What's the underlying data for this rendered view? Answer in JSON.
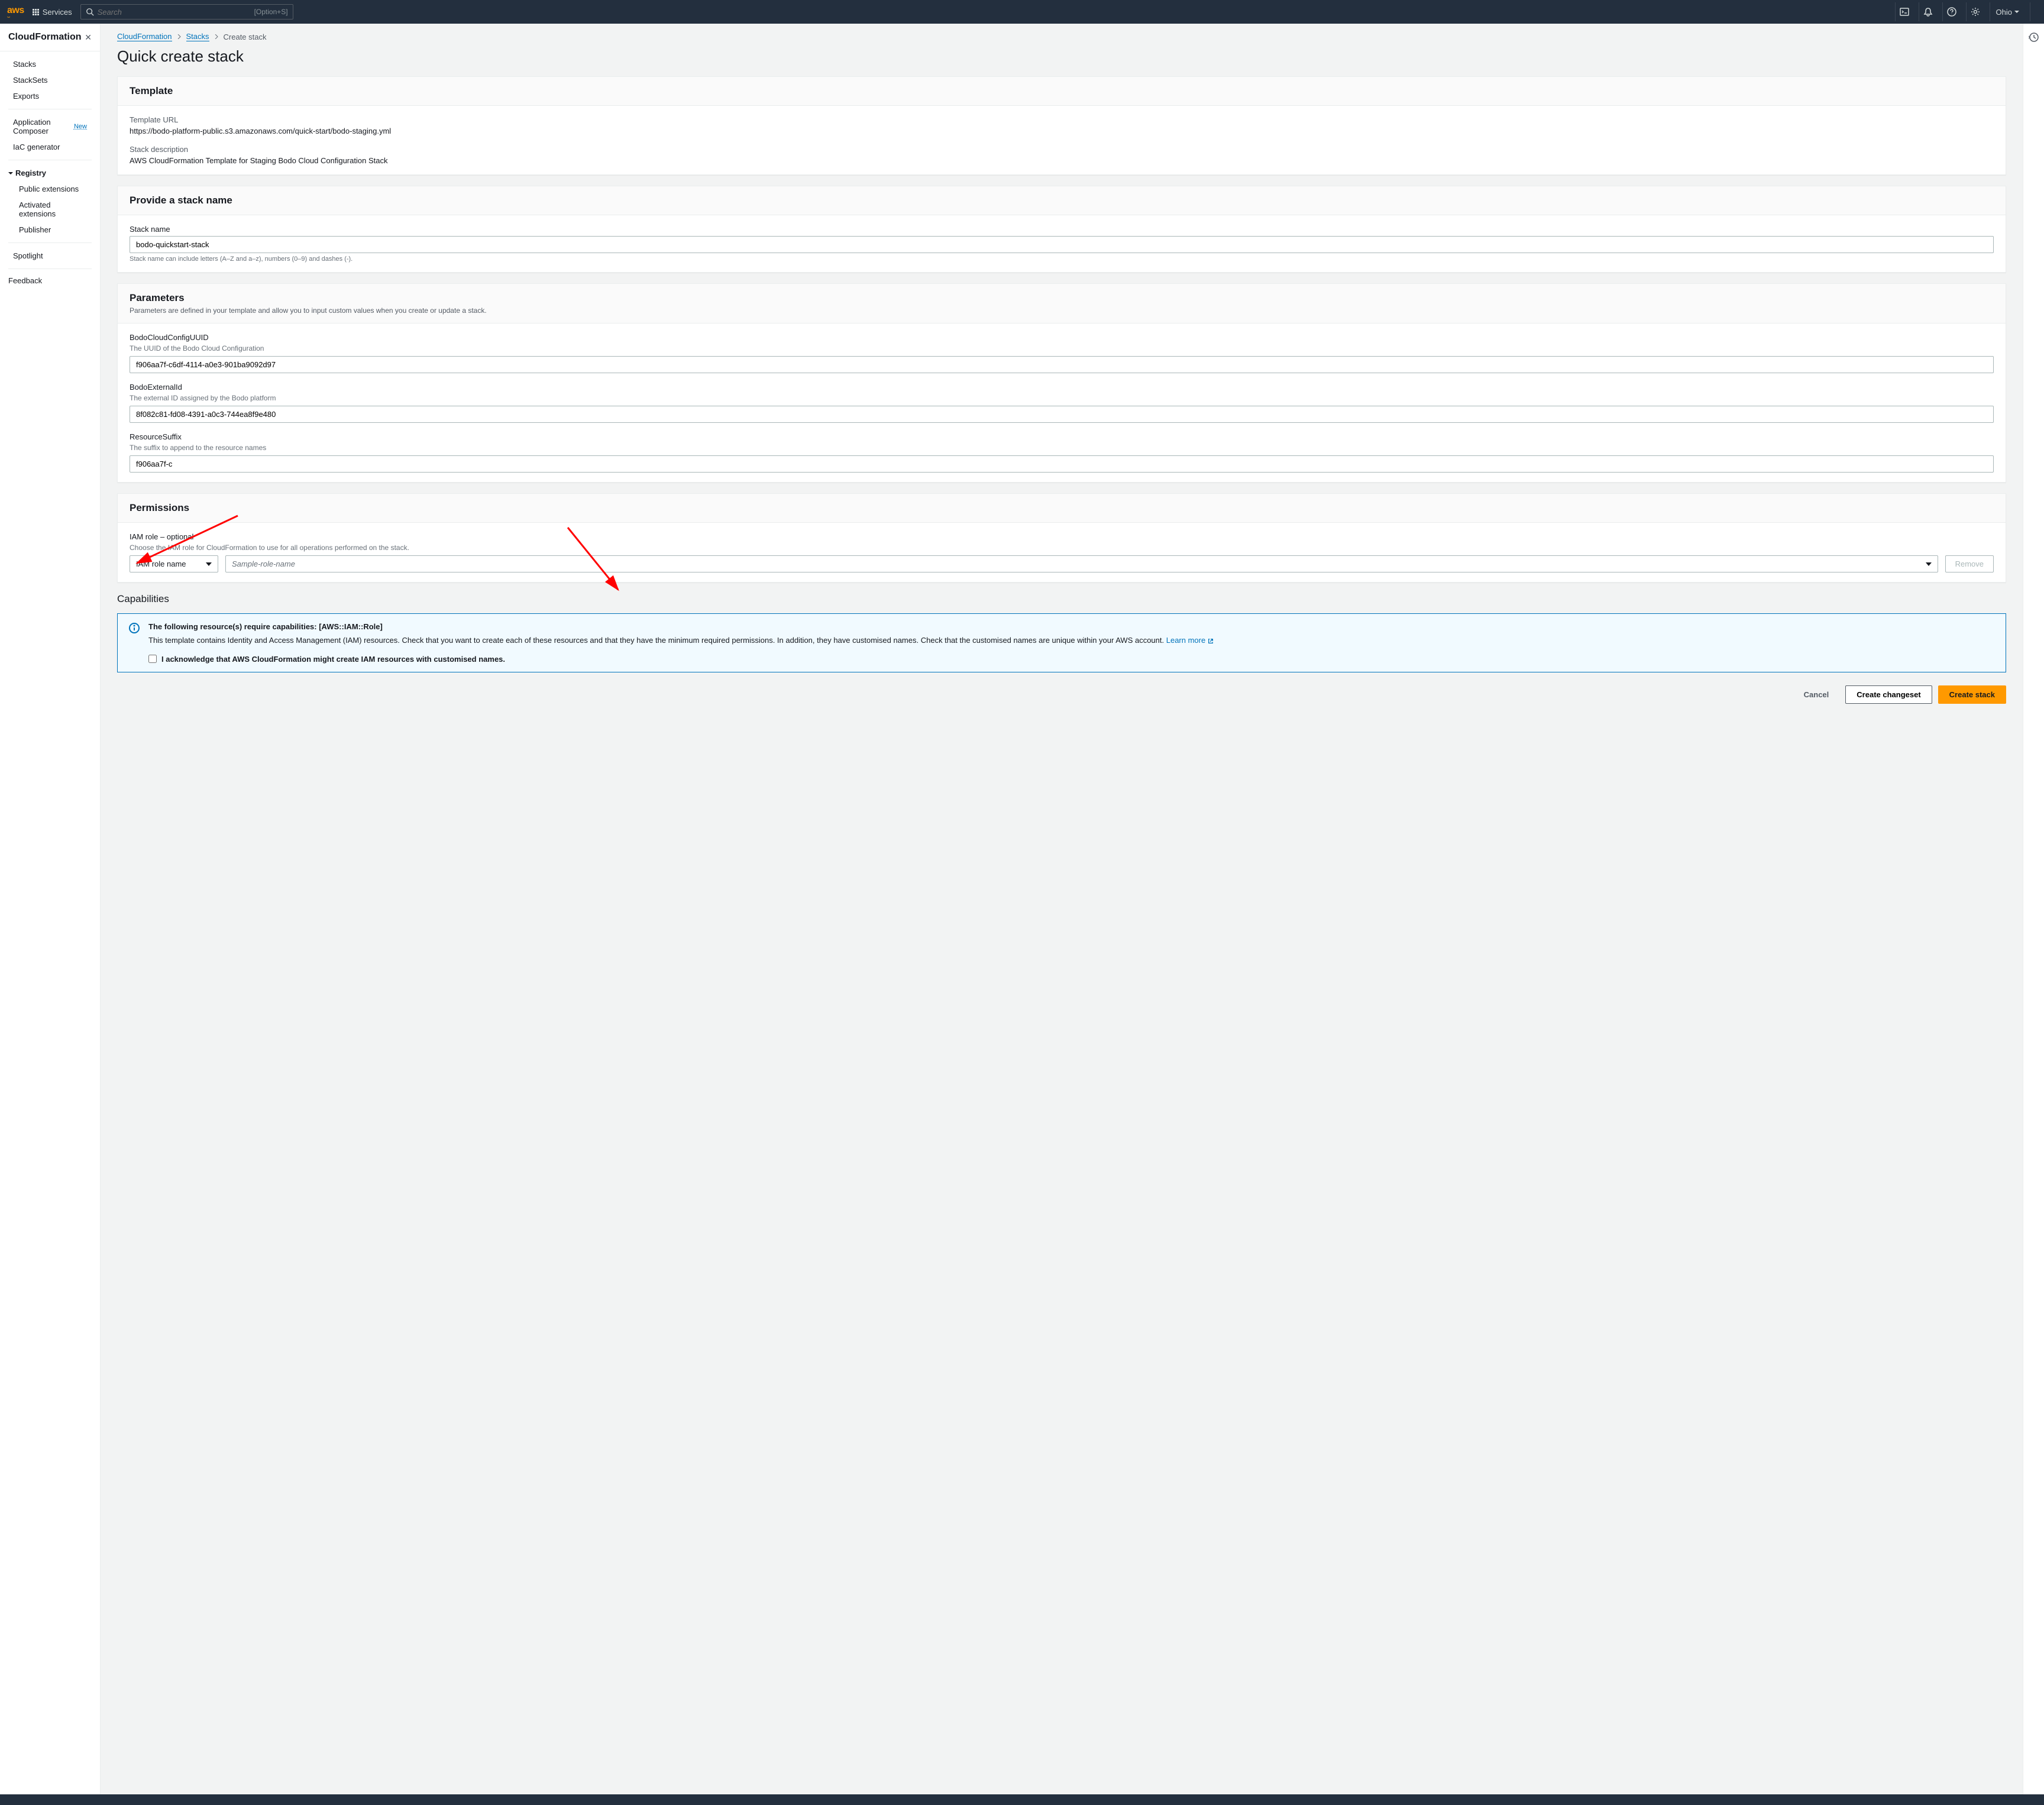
{
  "topnav": {
    "logo": "aws",
    "services_label": "Services",
    "search_placeholder": "Search",
    "search_shortcut": "[Option+S]",
    "region": "Ohio"
  },
  "sidebar": {
    "title": "CloudFormation",
    "section1": [
      "Stacks",
      "StackSets",
      "Exports"
    ],
    "section2": [
      {
        "label": "Application Composer",
        "badge": "New"
      },
      {
        "label": "IaC generator",
        "badge": null
      }
    ],
    "registry_label": "Registry",
    "registry_items": [
      "Public extensions",
      "Activated extensions",
      "Publisher"
    ],
    "section4": [
      "Spotlight"
    ],
    "feedback": "Feedback"
  },
  "breadcrumbs": {
    "items": [
      "CloudFormation",
      "Stacks",
      "Create stack"
    ]
  },
  "page_title": "Quick create stack",
  "template": {
    "heading": "Template",
    "url_label": "Template URL",
    "url_value": "https://bodo-platform-public.s3.amazonaws.com/quick-start/bodo-staging.yml",
    "desc_label": "Stack description",
    "desc_value": "AWS CloudFormation Template for Staging Bodo Cloud Configuration Stack"
  },
  "stack_name": {
    "heading": "Provide a stack name",
    "label": "Stack name",
    "value": "bodo-quickstart-stack",
    "hint": "Stack name can include letters (A–Z and a–z), numbers (0–9) and dashes (-)."
  },
  "parameters": {
    "heading": "Parameters",
    "subtitle": "Parameters are defined in your template and allow you to input custom values when you create or update a stack.",
    "items": [
      {
        "name": "BodoCloudConfigUUID",
        "desc": "The UUID of the Bodo Cloud Configuration",
        "value": "f906aa7f-c6df-4114-a0e3-901ba9092d97"
      },
      {
        "name": "BodoExternalId",
        "desc": "The external ID assigned by the Bodo platform",
        "value": "8f082c81-fd08-4391-a0c3-744ea8f9e480"
      },
      {
        "name": "ResourceSuffix",
        "desc": "The suffix to append to the resource names",
        "value": "f906aa7f-c"
      }
    ]
  },
  "permissions": {
    "heading": "Permissions",
    "iam_label": "IAM role – optional",
    "iam_desc": "Choose the IAM role for CloudFormation to use for all operations performed on the stack.",
    "type_selected": "IAM role name",
    "name_placeholder": "Sample-role-name",
    "remove_label": "Remove"
  },
  "capabilities": {
    "heading": "Capabilities",
    "info_title": "The following resource(s) require capabilities: [AWS::IAM::Role]",
    "info_text_1": "This template contains Identity and Access Management (IAM) resources. Check that you want to create each of these resources and that they have the minimum required permissions. In addition, they have customised names. Check that the customised names are unique within your AWS account. ",
    "learn_more": "Learn more",
    "ack_label": "I acknowledge that AWS CloudFormation might create IAM resources with customised names."
  },
  "footer": {
    "cancel": "Cancel",
    "changeset": "Create changeset",
    "create": "Create stack"
  }
}
